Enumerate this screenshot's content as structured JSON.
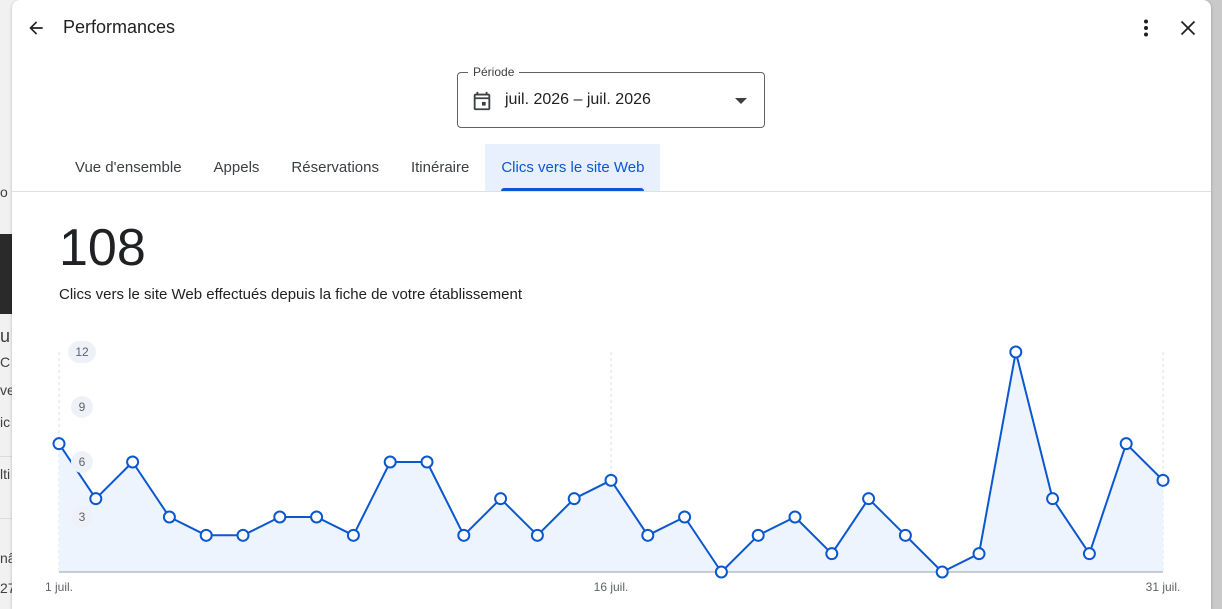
{
  "header": {
    "title": "Performances"
  },
  "period": {
    "label": "Période",
    "value": "juil. 2026 – juil. 2026"
  },
  "tabs": [
    {
      "label": "Vue d'ensemble",
      "active": false
    },
    {
      "label": "Appels",
      "active": false
    },
    {
      "label": "Réservations",
      "active": false
    },
    {
      "label": "Itinéraire",
      "active": false
    },
    {
      "label": "Clics vers le site Web",
      "active": true
    }
  ],
  "metric": {
    "total": "108",
    "description": "Clics vers le site Web effectués depuis la fiche de votre établissement"
  },
  "background_fragments": [
    "o",
    "u",
    "C",
    "ve",
    "ic",
    "lti",
    "nâ",
    "27"
  ],
  "colors": {
    "accent": "#0b57d0",
    "area_fill": "#eef4fd",
    "tab_active_bg": "#e8f0fe"
  },
  "chart_data": {
    "type": "line",
    "x": [
      1,
      2,
      3,
      4,
      5,
      6,
      7,
      8,
      9,
      10,
      11,
      12,
      13,
      14,
      15,
      16,
      17,
      18,
      19,
      20,
      21,
      22,
      23,
      24,
      25,
      26,
      27,
      28,
      29,
      30,
      31
    ],
    "values": [
      7,
      4,
      6,
      3,
      2,
      2,
      3,
      3,
      2,
      6,
      6,
      2,
      4,
      2,
      4,
      5,
      2,
      3,
      0,
      2,
      3,
      1,
      4,
      2,
      0,
      1,
      12,
      4,
      1,
      7,
      5
    ],
    "y_ticks": [
      "12",
      "9",
      "6",
      "3"
    ],
    "x_tick_labels": [
      {
        "x": 1,
        "label": "1 juil."
      },
      {
        "x": 16,
        "label": "16 juil."
      },
      {
        "x": 31,
        "label": "31 juil."
      }
    ],
    "ylim": [
      0,
      12
    ],
    "grid": "vertical-dashed"
  }
}
